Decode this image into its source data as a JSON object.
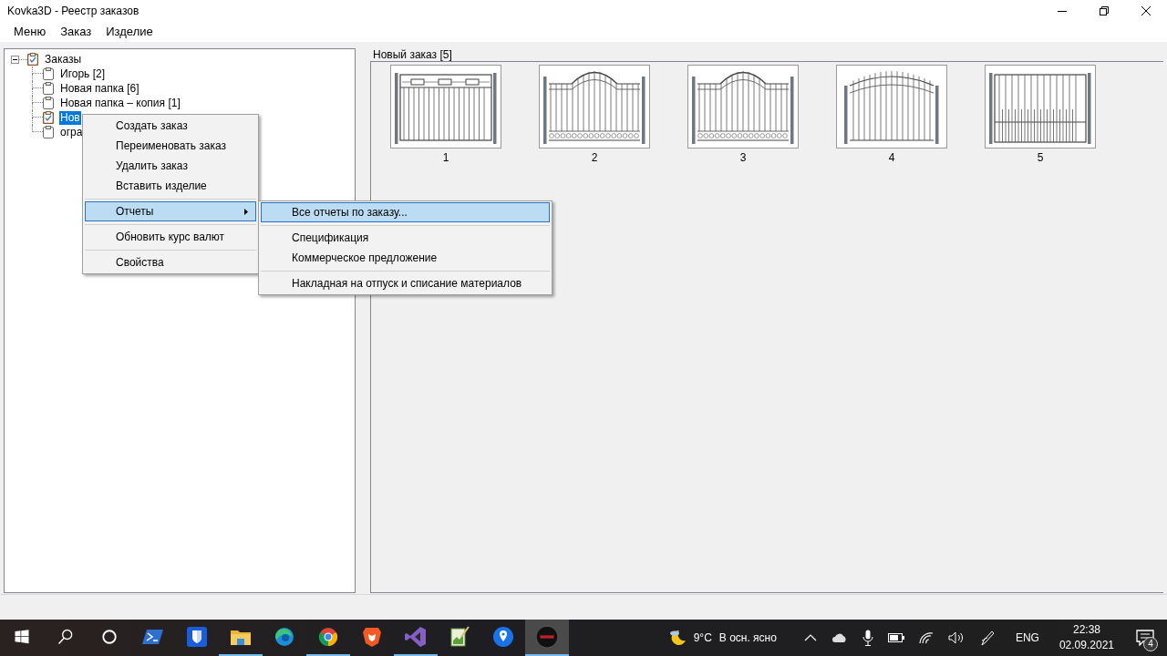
{
  "window": {
    "title": "Kovka3D - Реестр заказов"
  },
  "menu": [
    {
      "label": "Меню"
    },
    {
      "label": "Заказ"
    },
    {
      "label": "Изделие"
    }
  ],
  "tree": {
    "items": [
      {
        "label": "Заказы",
        "kind": "order",
        "expanded": true,
        "selected": false,
        "children": [
          {
            "label": "Игорь [2]",
            "kind": "folder",
            "selected": false
          },
          {
            "label": "Новая папка [6]",
            "kind": "folder",
            "selected": false
          },
          {
            "label": "Новая папка – копия [1]",
            "kind": "folder",
            "selected": false
          },
          {
            "label": "Нов",
            "kind": "order",
            "selected": true
          },
          {
            "label": "огра",
            "kind": "folder",
            "selected": false
          }
        ]
      }
    ]
  },
  "order_panel": {
    "title": "Новый заказ [5]",
    "thumbnails": [
      {
        "kind": "panels",
        "caption": "1"
      },
      {
        "kind": "arched-ornament",
        "caption": "2"
      },
      {
        "kind": "arched-ornament",
        "caption": "3"
      },
      {
        "kind": "arched-spikes",
        "caption": "4"
      },
      {
        "kind": "pickets",
        "caption": "5"
      }
    ]
  },
  "context_menu": {
    "items": [
      {
        "kind": "item",
        "label": "Создать заказ",
        "selected": false
      },
      {
        "kind": "item",
        "label": "Переименовать заказ",
        "selected": false
      },
      {
        "kind": "item",
        "label": "Удалить заказ",
        "selected": false
      },
      {
        "kind": "item",
        "label": "Вставить изделие",
        "selected": false
      },
      {
        "kind": "separator"
      },
      {
        "kind": "submenu",
        "label": "Отчеты",
        "selected": true
      },
      {
        "kind": "separator"
      },
      {
        "kind": "item",
        "label": "Обновить курс валют",
        "selected": false
      },
      {
        "kind": "separator"
      },
      {
        "kind": "item",
        "label": "Свойства",
        "selected": false
      }
    ]
  },
  "submenu": {
    "items": [
      {
        "kind": "item",
        "label": "Все отчеты по заказу...",
        "selected": true
      },
      {
        "kind": "separator"
      },
      {
        "kind": "item",
        "label": "Спецификация",
        "selected": false
      },
      {
        "kind": "item",
        "label": "Коммерческое предложение",
        "selected": false
      },
      {
        "kind": "separator"
      },
      {
        "kind": "item",
        "label": "Накладная на отпуск и списание материалов",
        "selected": false
      }
    ]
  },
  "taskbar": {
    "apps": [
      {
        "kind": "start",
        "running": false,
        "active": false
      },
      {
        "kind": "search",
        "running": false,
        "active": false
      },
      {
        "kind": "cortana",
        "running": false,
        "active": false
      },
      {
        "kind": "terminal",
        "running": false,
        "active": false
      },
      {
        "kind": "shield",
        "running": false,
        "active": false
      },
      {
        "kind": "folder",
        "running": true,
        "active": false
      },
      {
        "kind": "edge",
        "running": false,
        "active": false
      },
      {
        "kind": "chrome",
        "running": true,
        "active": false
      },
      {
        "kind": "lion",
        "running": false,
        "active": false
      },
      {
        "kind": "ribbon",
        "running": true,
        "active": false
      },
      {
        "kind": "notepad",
        "running": false,
        "active": false
      },
      {
        "kind": "pin",
        "running": false,
        "active": false
      },
      {
        "kind": "record",
        "running": true,
        "active": true
      }
    ],
    "tray": {
      "temperature": "9°C",
      "weather": "В осн. ясно",
      "language": "ENG",
      "time": "22:38",
      "date": "02.09.2021",
      "notifications": "4"
    }
  }
}
